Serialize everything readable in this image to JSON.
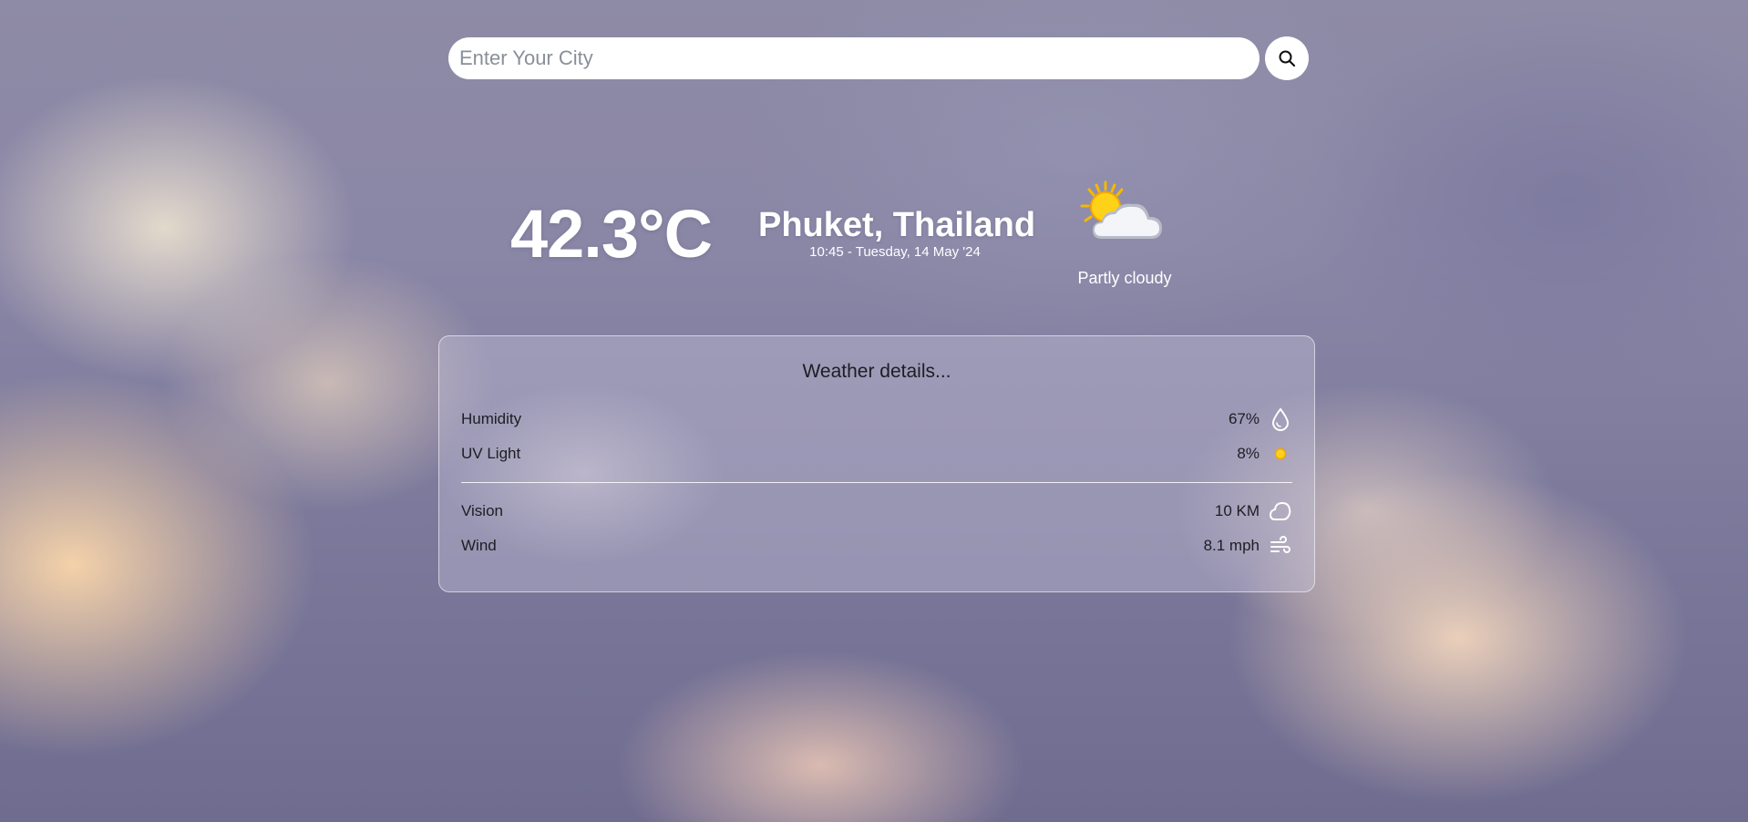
{
  "search": {
    "placeholder": "Enter Your City",
    "value": "",
    "button_icon": "search-icon"
  },
  "current": {
    "temperature": "42.3°C",
    "location": "Phuket, Thailand",
    "datetime": "10:45 - Tuesday, 14 May '24",
    "condition": "Partly cloudy",
    "condition_icon": "partly-cloudy-icon"
  },
  "details": {
    "title": "Weather details...",
    "rows": [
      {
        "label": "Humidity",
        "value": "67%",
        "icon": "droplet-icon"
      },
      {
        "label": "UV Light",
        "value": "8%",
        "icon": "sun-dot-icon"
      },
      {
        "label": "Vision",
        "value": "10 KM",
        "icon": "cloud-outline-icon"
      },
      {
        "label": "Wind",
        "value": "8.1 mph",
        "icon": "wind-icon"
      }
    ]
  },
  "colors": {
    "text_light": "#ffffff",
    "text_dark": "#1d1d24",
    "sun": "#f5b800",
    "card_border": "rgba(255,255,255,0.55)"
  }
}
